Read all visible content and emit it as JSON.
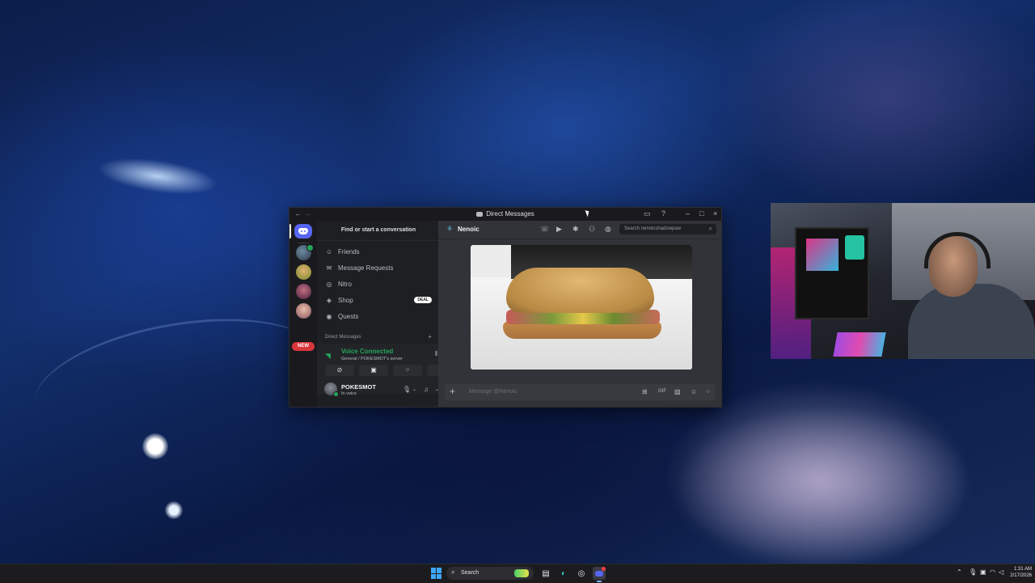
{
  "window": {
    "title": "Direct Messages",
    "nav_back": "←",
    "nav_forward": "→",
    "icons": [
      "inbox-icon",
      "help-icon",
      "minimize-icon",
      "maximize-icon",
      "close-icon"
    ]
  },
  "sidebar": {
    "find_conversation": "Find or start a conversation",
    "nav": [
      {
        "label": "Friends",
        "icon": "friends-icon"
      },
      {
        "label": "Message Requests",
        "icon": "mail-icon"
      },
      {
        "label": "Nitro",
        "icon": "nitro-icon"
      },
      {
        "label": "Shop",
        "icon": "shop-icon",
        "badge": "DEAL"
      },
      {
        "label": "Quests",
        "icon": "quests-icon"
      }
    ],
    "dm_header": "Direct Messages",
    "dm_add": "+"
  },
  "server_rail": {
    "new_badge": "NEW"
  },
  "voice": {
    "title": "Voice Connected",
    "subtitle": "General / POKESMOT's server",
    "status_color": "#23a55a"
  },
  "user": {
    "name": "POKESMOT",
    "status": "In voice"
  },
  "chat": {
    "recipient": "Nenoic",
    "search_placeholder": "Search nenoicshadowpaw",
    "composer_placeholder": "Message @Nenoic",
    "composer_gif": "GIF",
    "attachment": "sandwich-photo"
  },
  "taskbar": {
    "search": "Search",
    "time": "1:31 AM",
    "date": "2/17/2026"
  },
  "colors": {
    "accent": "#5865f2",
    "online": "#23a55a",
    "danger": "#da373c"
  }
}
